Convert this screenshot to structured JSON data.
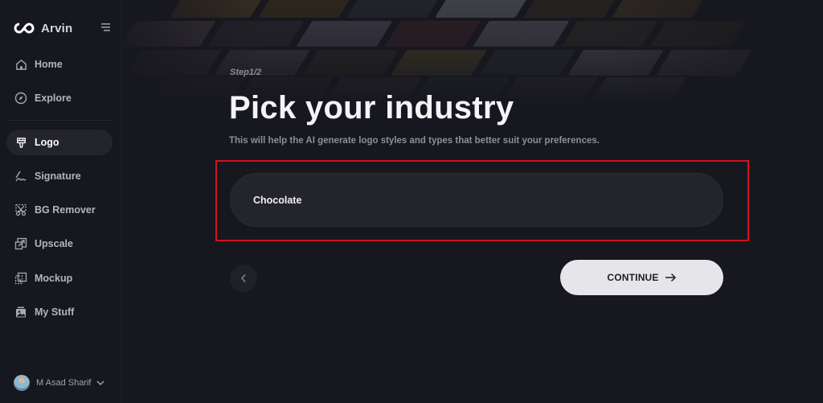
{
  "app": {
    "name": "Arvin"
  },
  "sidebar": {
    "items": [
      {
        "label": "Home",
        "icon": "home-icon",
        "active": false
      },
      {
        "label": "Explore",
        "icon": "compass-icon",
        "active": false
      },
      {
        "label": "Logo",
        "icon": "paintbrush-icon",
        "active": true
      },
      {
        "label": "Signature",
        "icon": "signature-icon",
        "active": false
      },
      {
        "label": "BG Remover",
        "icon": "scissors-icon",
        "active": false
      },
      {
        "label": "Upscale",
        "icon": "upscale-icon",
        "active": false
      },
      {
        "label": "Mockup",
        "icon": "mockup-icon",
        "active": false
      },
      {
        "label": "My Stuff",
        "icon": "image-folder-icon",
        "active": false
      }
    ],
    "user": {
      "name": "M Asad Sharif"
    }
  },
  "main": {
    "step": "Step1/2",
    "title": "Pick your industry",
    "subtitle": "This will help the AI generate logo styles and types that better suit your preferences.",
    "industry_input": {
      "value": "Chocolate"
    },
    "continue_label": "CONTINUE"
  },
  "colors": {
    "background": "#17171f",
    "active_nav": "#24242d",
    "highlight_border": "#d0121f",
    "continue_button": "#e6e6ea"
  }
}
